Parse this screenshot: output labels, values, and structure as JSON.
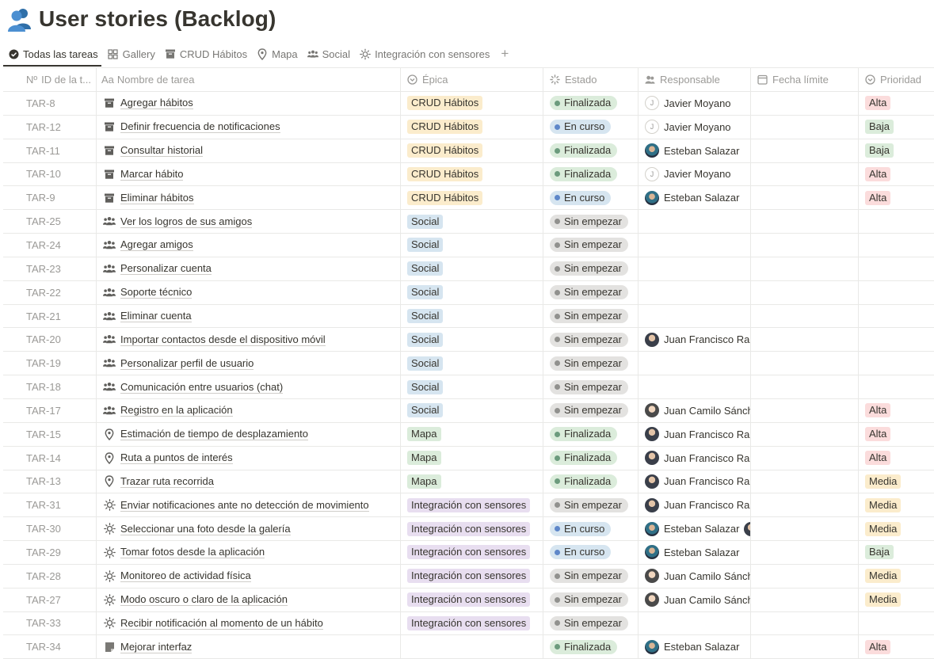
{
  "page": {
    "title": "User stories (Backlog)",
    "icon": "people-icon"
  },
  "tabs": [
    {
      "label": "Todas las tareas",
      "icon": "check-circle-icon",
      "active": true
    },
    {
      "label": "Gallery",
      "icon": "gallery-icon"
    },
    {
      "label": "CRUD Hábitos",
      "icon": "archive-icon"
    },
    {
      "label": "Mapa",
      "icon": "pin-icon"
    },
    {
      "label": "Social",
      "icon": "group-icon"
    },
    {
      "label": "Integración con sensores",
      "icon": "sun-icon"
    }
  ],
  "add_tab": "+",
  "columns": {
    "id": "ID de la t...",
    "id_prefix": "Nº",
    "name": "Nombre de tarea",
    "name_prefix": "Aa",
    "epic": "Épica",
    "estado": "Estado",
    "responsable": "Responsable",
    "fecha": "Fecha límite",
    "prioridad": "Prioridad"
  },
  "colors": {
    "epic": {
      "CRUD Hábitos": "#fbeccc",
      "Social": "#d6e5f0",
      "Mapa": "#dbecdb",
      "Integración con sensores": "#e8def0"
    },
    "estado": {
      "Finalizada": {
        "bg": "#dbecdb",
        "dot": "#6c9b7d"
      },
      "En curso": {
        "bg": "#d6e5f0",
        "dot": "#5e87c9"
      },
      "Sin empezar": {
        "bg": "#e3e2e0",
        "dot": "#91918e"
      }
    },
    "prioridad": {
      "Alta": "#fbdcdc",
      "Baja": "#dbecdb",
      "Media": "#fbeccc"
    }
  },
  "rows": [
    {
      "id": "TAR-8",
      "icon": "archive-icon",
      "name": "Agregar hábitos",
      "epic": "CRUD Hábitos",
      "estado": "Finalizada",
      "responsable": "Javier Moyano",
      "avatar": "initial",
      "prioridad": "Alta"
    },
    {
      "id": "TAR-12",
      "icon": "archive-icon",
      "name": "Definir frecuencia de notificaciones",
      "epic": "CRUD Hábitos",
      "estado": "En curso",
      "responsable": "Javier Moyano",
      "avatar": "initial",
      "prioridad": "Baja"
    },
    {
      "id": "TAR-11",
      "icon": "archive-icon",
      "name": "Consultar historial",
      "epic": "CRUD Hábitos",
      "estado": "Finalizada",
      "responsable": "Esteban Salazar",
      "avatar": "photo2",
      "prioridad": "Baja"
    },
    {
      "id": "TAR-10",
      "icon": "archive-icon",
      "name": "Marcar hábito",
      "epic": "CRUD Hábitos",
      "estado": "Finalizada",
      "responsable": "Javier Moyano",
      "avatar": "initial",
      "prioridad": "Alta"
    },
    {
      "id": "TAR-9",
      "icon": "archive-icon",
      "name": "Eliminar hábitos",
      "epic": "CRUD Hábitos",
      "estado": "En curso",
      "responsable": "Esteban Salazar",
      "avatar": "photo2",
      "prioridad": "Alta"
    },
    {
      "id": "TAR-25",
      "icon": "group-icon",
      "name": "Ver los logros de sus amigos",
      "epic": "Social",
      "estado": "Sin empezar",
      "responsable": "",
      "prioridad": ""
    },
    {
      "id": "TAR-24",
      "icon": "group-icon",
      "name": "Agregar amigos",
      "epic": "Social",
      "estado": "Sin empezar",
      "responsable": "",
      "prioridad": ""
    },
    {
      "id": "TAR-23",
      "icon": "group-icon",
      "name": "Personalizar cuenta",
      "epic": "Social",
      "estado": "Sin empezar",
      "responsable": "",
      "prioridad": ""
    },
    {
      "id": "TAR-22",
      "icon": "group-icon",
      "name": "Soporte técnico",
      "epic": "Social",
      "estado": "Sin empezar",
      "responsable": "",
      "prioridad": ""
    },
    {
      "id": "TAR-21",
      "icon": "group-icon",
      "name": "Eliminar cuenta",
      "epic": "Social",
      "estado": "Sin empezar",
      "responsable": "",
      "prioridad": ""
    },
    {
      "id": "TAR-20",
      "icon": "group-icon",
      "name": "Importar contactos desde el dispositivo móvil",
      "epic": "Social",
      "estado": "Sin empezar",
      "responsable": "Juan Francisco Rami",
      "avatar": "photo",
      "prioridad": ""
    },
    {
      "id": "TAR-19",
      "icon": "group-icon",
      "name": "Personalizar perfil de usuario",
      "epic": "Social",
      "estado": "Sin empezar",
      "responsable": "",
      "prioridad": ""
    },
    {
      "id": "TAR-18",
      "icon": "group-icon",
      "name": "Comunicación entre usuarios (chat)",
      "epic": "Social",
      "estado": "Sin empezar",
      "responsable": "",
      "prioridad": ""
    },
    {
      "id": "TAR-17",
      "icon": "group-icon",
      "name": "Registro en la aplicación",
      "epic": "Social",
      "estado": "Sin empezar",
      "responsable": "Juan Camilo Sánche",
      "avatar": "photo3",
      "prioridad": "Alta"
    },
    {
      "id": "TAR-15",
      "icon": "pin-icon",
      "name": "Estimación de tiempo de desplazamiento",
      "epic": "Mapa",
      "estado": "Finalizada",
      "responsable": "Juan Francisco Rami",
      "avatar": "photo",
      "prioridad": "Alta"
    },
    {
      "id": "TAR-14",
      "icon": "pin-icon",
      "name": "Ruta a puntos de interés",
      "epic": "Mapa",
      "estado": "Finalizada",
      "responsable": "Juan Francisco Rami",
      "avatar": "photo",
      "prioridad": "Alta"
    },
    {
      "id": "TAR-13",
      "icon": "pin-icon",
      "name": "Trazar ruta recorrida",
      "epic": "Mapa",
      "estado": "Finalizada",
      "responsable": "Juan Francisco Rami",
      "avatar": "photo",
      "prioridad": "Media"
    },
    {
      "id": "TAR-31",
      "icon": "sun-icon",
      "name": "Enviar notificaciones ante no detección de movimiento",
      "epic": "Integración con sensores",
      "estado": "Sin empezar",
      "responsable": "Juan Francisco Rami",
      "avatar": "photo",
      "prioridad": "Media"
    },
    {
      "id": "TAR-30",
      "icon": "sun-icon",
      "name": "Seleccionar una foto desde la galería",
      "epic": "Integración con sensores",
      "estado": "En curso",
      "responsable": "Esteban Salazar",
      "avatar": "photo2",
      "extra_avatar": true,
      "prioridad": "Media"
    },
    {
      "id": "TAR-29",
      "icon": "sun-icon",
      "name": "Tomar fotos desde la aplicación",
      "epic": "Integración con sensores",
      "estado": "En curso",
      "responsable": "Esteban Salazar",
      "avatar": "photo2",
      "prioridad": "Baja"
    },
    {
      "id": "TAR-28",
      "icon": "sun-icon",
      "name": "Monitoreo de actividad física",
      "epic": "Integración con sensores",
      "estado": "Sin empezar",
      "responsable": "Juan Camilo Sánche",
      "avatar": "photo3",
      "prioridad": "Media"
    },
    {
      "id": "TAR-27",
      "icon": "sun-icon",
      "name": "Modo oscuro o claro de la aplicación",
      "epic": "Integración con sensores",
      "estado": "Sin empezar",
      "responsable": "Juan Camilo Sánche",
      "avatar": "photo3",
      "prioridad": "Media"
    },
    {
      "id": "TAR-33",
      "icon": "sun-icon",
      "name": "Recibir notificación al momento de un hábito",
      "epic": "Integración con sensores",
      "estado": "Sin empezar",
      "responsable": "",
      "prioridad": ""
    },
    {
      "id": "TAR-34",
      "icon": "page-icon",
      "name": "Mejorar interfaz",
      "epic": "",
      "estado": "Finalizada",
      "responsable": "Esteban Salazar",
      "avatar": "photo2",
      "prioridad": "Alta"
    }
  ]
}
